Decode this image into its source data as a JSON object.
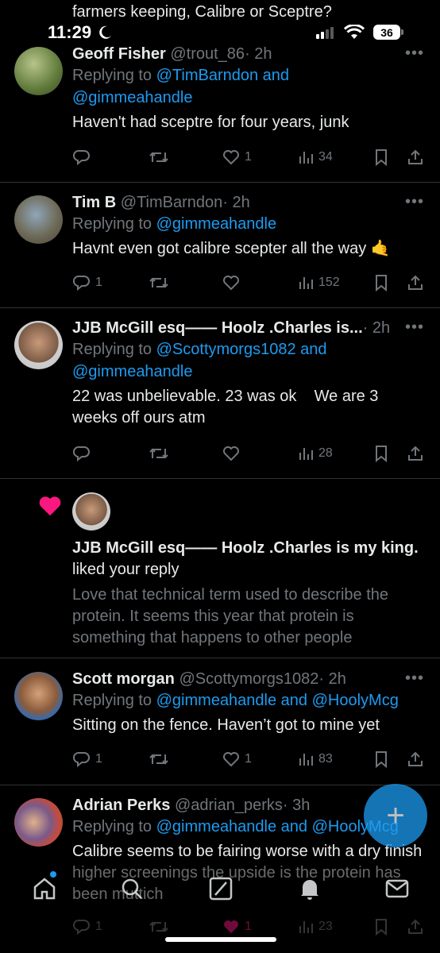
{
  "top_snippet": "farmers keeping, Calibre or Sceptre?",
  "status": {
    "time": "11:29",
    "battery": "36"
  },
  "tweets": [
    {
      "name": "Geoff Fisher",
      "handle": "@trout_86",
      "time": "· 2h",
      "replying_prefix": "Replying to ",
      "replying_links": "@TimBarndon and",
      "replying_links2": "@gimmeahandle",
      "text": "Haven't had sceptre for four years, junk",
      "reply_count": "",
      "like_count": "1",
      "views": "34"
    },
    {
      "name": "Tim B",
      "handle": "@TimBarndon",
      "time": "· 2h",
      "replying_prefix": "Replying to ",
      "replying_links": "@gimmeahandle",
      "text": "Havnt even got calibre scepter all the way 🤙",
      "reply_count": "1",
      "like_count": "",
      "views": "152"
    },
    {
      "name": "JJB McGill esq—— Hoolz .Charles is...",
      "handle": "",
      "time": "· 2h",
      "replying_prefix": "Replying to ",
      "replying_links": "@Scottymorgs1082 and",
      "replying_links2": "@gimmeahandle",
      "text": "22 was unbelievable. 23 was ok    We are 3 weeks off ours atm",
      "reply_count": "",
      "like_count": "",
      "views": "28"
    },
    {
      "name": "Scott morgan",
      "handle": "@Scottymorgs1082",
      "time": "· 2h",
      "replying_prefix": "Replying to ",
      "replying_links": "@gimmeahandle and @HoolyMcg",
      "text": "Sitting on the fence. Haven’t got to mine yet",
      "reply_count": "1",
      "like_count": "1",
      "views": "83"
    },
    {
      "name": "Adrian Perks",
      "handle": "@adrian_perks",
      "time": "· 3h",
      "replying_prefix": "Replying to ",
      "replying_links": "@gimmeahandle and @HoolyMcg",
      "text": "Calibre seems to be fairing worse with a dry finish higher screenings the upside is the protein has been muttich",
      "reply_count": "1",
      "like_count": "1",
      "views": "23"
    }
  ],
  "notification": {
    "name": "JJB McGill esq—— Hoolz .Charles is my king.",
    "action": "liked your reply",
    "quote": "Love that technical term used to describe the protein. It seems this year that protein is something that happens to other people"
  },
  "colors": {
    "accent": "#1d9bf0",
    "like": "#f91880",
    "muted": "#71767b"
  },
  "nav_icons": [
    "home-icon",
    "search-icon",
    "grok-icon",
    "notifications-icon",
    "messages-icon"
  ]
}
